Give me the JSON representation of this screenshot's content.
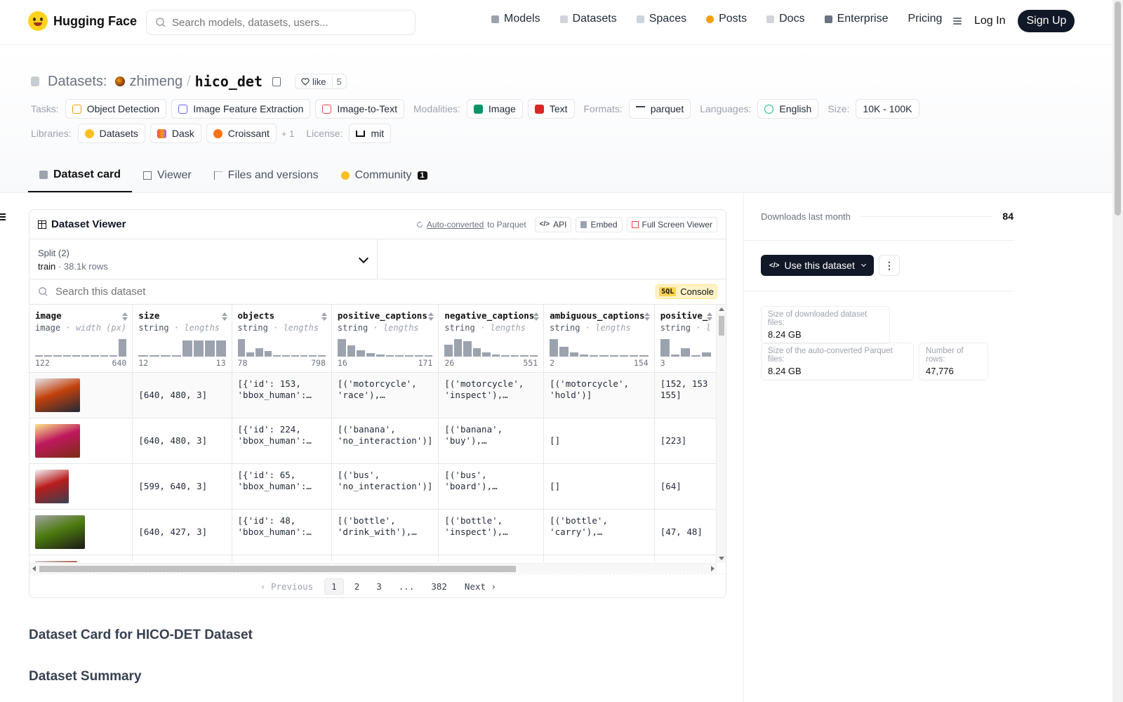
{
  "nav": {
    "brand": "Hugging Face",
    "search_placeholder": "Search models, datasets, users...",
    "links": [
      {
        "label": "Models",
        "color": "#9ca3af"
      },
      {
        "label": "Datasets",
        "color": "#d1d5db"
      },
      {
        "label": "Spaces",
        "color": "#cbd5e1"
      },
      {
        "label": "Posts",
        "color": "#f59e0b"
      },
      {
        "label": "Docs",
        "color": "#d1d5db"
      },
      {
        "label": "Enterprise",
        "color": "#6b7280"
      },
      {
        "label": "Pricing",
        "color": ""
      }
    ],
    "login": "Log In",
    "signup": "Sign Up"
  },
  "header": {
    "section": "Datasets:",
    "owner": "zhimeng",
    "separator": "/",
    "dataset": "hico_det",
    "like_label": "like",
    "like_count": "5",
    "tasks_label": "Tasks:",
    "tasks": [
      "Object Detection",
      "Image Feature Extraction",
      "Image-to-Text"
    ],
    "modalities_label": "Modalities:",
    "modalities": [
      "Image",
      "Text"
    ],
    "formats_label": "Formats:",
    "formats": [
      "parquet"
    ],
    "languages_label": "Languages:",
    "languages": [
      "English"
    ],
    "size_label": "Size:",
    "size": "10K - 100K",
    "libraries_label": "Libraries:",
    "libraries": [
      "Datasets",
      "Dask",
      "Croissant"
    ],
    "libraries_more": "+ 1",
    "license_label": "License:",
    "license": "mit"
  },
  "tabs": [
    {
      "label": "Dataset card",
      "active": true
    },
    {
      "label": "Viewer",
      "active": false
    },
    {
      "label": "Files and versions",
      "active": false
    },
    {
      "label": "Community",
      "active": false,
      "badge": "1"
    }
  ],
  "viewer": {
    "title": "Dataset Viewer",
    "auto_converted": "Auto-converted",
    "to_parquet": "to Parquet",
    "api": "API",
    "embed": "Embed",
    "full_screen": "Full Screen Viewer",
    "split_label": "Split (2)",
    "split_name": "train",
    "split_dot": "·",
    "split_rows": "38.1k rows",
    "search_placeholder": "Search this dataset",
    "sql_tag": "SQL",
    "console": "Console",
    "columns": [
      {
        "name": "image",
        "type": "image",
        "sub": "width (px)",
        "min": "122",
        "max": "640",
        "hist": [
          0.02,
          0.02,
          0.02,
          0.02,
          0.03,
          0.08,
          0.06,
          0.03,
          0.02,
          0.95
        ]
      },
      {
        "name": "size",
        "type": "string",
        "sub": "lengths",
        "min": "12",
        "max": "13",
        "hist": [
          0.02,
          0.02,
          0.02,
          0.02,
          0.9,
          0.9,
          0.9,
          0.9
        ]
      },
      {
        "name": "objects",
        "type": "string",
        "sub": "lengths",
        "min": "78",
        "max": "798",
        "hist": [
          0.95,
          0.25,
          0.45,
          0.3,
          0.05,
          0.05,
          0.02,
          0.02,
          0.02,
          0.02
        ]
      },
      {
        "name": "positive_captions",
        "type": "string",
        "sub": "lengths",
        "min": "16",
        "max": "171",
        "hist": [
          0.95,
          0.6,
          0.35,
          0.2,
          0.1,
          0.06,
          0.04,
          0.02,
          0.02,
          0.02
        ]
      },
      {
        "name": "negative_captions",
        "type": "string",
        "sub": "lengths",
        "min": "26",
        "max": "551",
        "hist": [
          0.65,
          0.95,
          0.85,
          0.45,
          0.25,
          0.12,
          0.06,
          0.03,
          0.02,
          0.02
        ]
      },
      {
        "name": "ambiguous_captions",
        "type": "string",
        "sub": "lengths",
        "min": "2",
        "max": "154",
        "hist": [
          0.95,
          0.55,
          0.25,
          0.12,
          0.06,
          0.04,
          0.03,
          0.02,
          0.02,
          0.02
        ]
      },
      {
        "name": "positive_",
        "type": "string",
        "sub": "l",
        "min": "3",
        "max": "",
        "hist": [
          0.95,
          0.1,
          0.45,
          0.05,
          0.25
        ]
      }
    ],
    "rows": [
      {
        "image": {
          "w": 64,
          "h": 48,
          "palette": [
            "#c2410c",
            "#e5e7eb",
            "#1f2937"
          ]
        },
        "size": "[640, 480, 3]",
        "objects": "[{'id': 153,\n'bbox_human':…",
        "positive": "[('motorcycle',\n'race'),…",
        "negative": "[('motorcycle',\n'inspect'),…",
        "ambiguous": "[('motorcycle',\n'hold')]",
        "positive_ids": "[152, 153\n155]"
      },
      {
        "image": {
          "w": 64,
          "h": 48,
          "palette": [
            "#be185d",
            "#fde68a",
            "#7c2d12"
          ]
        },
        "size": "[640, 480, 3]",
        "objects": "[{'id': 224,\n'bbox_human':…",
        "positive": "[('banana',\n'no_interaction')]",
        "negative": "[('banana', 'buy'),\n('banana',…",
        "ambiguous": "[]",
        "positive_ids": "[223]"
      },
      {
        "image": {
          "w": 48,
          "h": 48,
          "palette": [
            "#b91c1c",
            "#f3f4f6",
            "#374151"
          ]
        },
        "size": "[599, 640, 3]",
        "objects": "[{'id': 65,\n'bbox_human':…",
        "positive": "[('bus',\n'no_interaction')]",
        "negative": "[('bus', 'board'),\n('bus', 'direct'),…",
        "ambiguous": "[]",
        "positive_ids": "[64]"
      },
      {
        "image": {
          "w": 71,
          "h": 48,
          "palette": [
            "#4d7c0f",
            "#a3a3a3",
            "#1c1917"
          ]
        },
        "size": "[640, 427, 3]",
        "objects": "[{'id': 48,\n'bbox_human':…",
        "positive": "[('bottle',\n'drink_with'),…",
        "negative": "[('bottle',\n'inspect'),…",
        "ambiguous": "[('bottle',\n'carry'), ('bottle'…",
        "positive_ids": "[47, 48]"
      },
      {
        "image": {
          "w": 60,
          "h": 48,
          "palette": [
            "#9a3412",
            "#d6d3d1",
            "#44403c"
          ]
        },
        "size": "",
        "objects": "",
        "positive": "",
        "negative": "",
        "ambiguous": "",
        "positive_ids": ""
      }
    ],
    "pager": {
      "prev": "Previous",
      "pages": [
        "1",
        "2",
        "3",
        "...",
        "382"
      ],
      "next": "Next",
      "current": "1"
    }
  },
  "card": {
    "title": "Dataset Card for HICO-DET Dataset",
    "summary": "Dataset Summary"
  },
  "sidebar": {
    "downloads_label": "Downloads last month",
    "downloads": "84",
    "use_button": "Use this dataset",
    "more": "⋮",
    "dl_size_label": "Size of downloaded dataset files:",
    "dl_size": "8.24 GB",
    "parquet_size_label": "Size of the auto-converted Parquet files:",
    "parquet_size": "8.24 GB",
    "rows_label": "Number of rows:",
    "rows": "47,776"
  }
}
